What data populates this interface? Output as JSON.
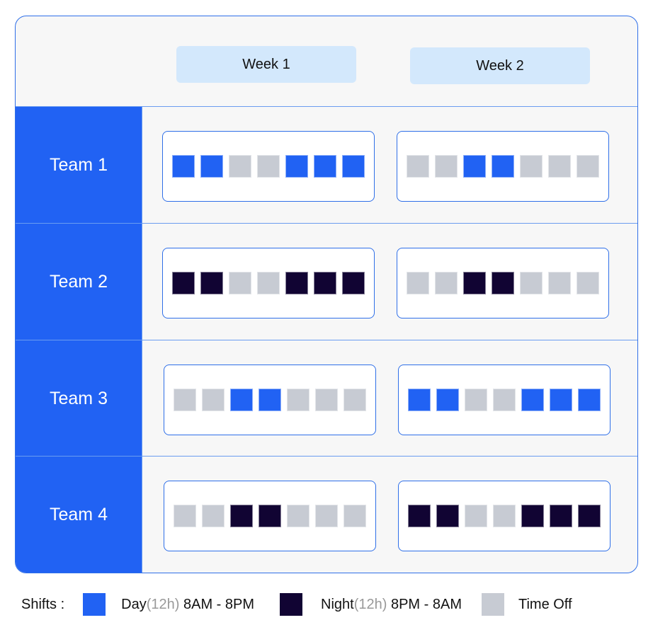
{
  "weeks": [
    "Week 1",
    "Week 2"
  ],
  "colors": {
    "day": "#2162f3",
    "night": "#110433",
    "off": "#c7cbd3"
  },
  "teams": [
    {
      "label": "Team 1",
      "weeks": [
        [
          "day",
          "day",
          "off",
          "off",
          "day",
          "day",
          "day"
        ],
        [
          "off",
          "off",
          "day",
          "day",
          "off",
          "off",
          "off"
        ]
      ]
    },
    {
      "label": "Team 2",
      "weeks": [
        [
          "night",
          "night",
          "off",
          "off",
          "night",
          "night",
          "night"
        ],
        [
          "off",
          "off",
          "night",
          "night",
          "off",
          "off",
          "off"
        ]
      ]
    },
    {
      "label": "Team 3",
      "weeks": [
        [
          "off",
          "off",
          "day",
          "day",
          "off",
          "off",
          "off"
        ],
        [
          "day",
          "day",
          "off",
          "off",
          "day",
          "day",
          "day"
        ]
      ]
    },
    {
      "label": "Team 4",
      "weeks": [
        [
          "off",
          "off",
          "night",
          "night",
          "off",
          "off",
          "off"
        ],
        [
          "night",
          "night",
          "off",
          "off",
          "night",
          "night",
          "night"
        ]
      ]
    }
  ],
  "legend": {
    "title": "Shifts :",
    "items": [
      {
        "key": "day",
        "name": "Day",
        "duration": "(12h)",
        "hours": " 8AM - 8PM"
      },
      {
        "key": "night",
        "name": "Night",
        "duration": "(12h)",
        "hours": " 8PM - 8AM"
      },
      {
        "key": "off",
        "name": "Time Off",
        "duration": "",
        "hours": ""
      }
    ]
  }
}
